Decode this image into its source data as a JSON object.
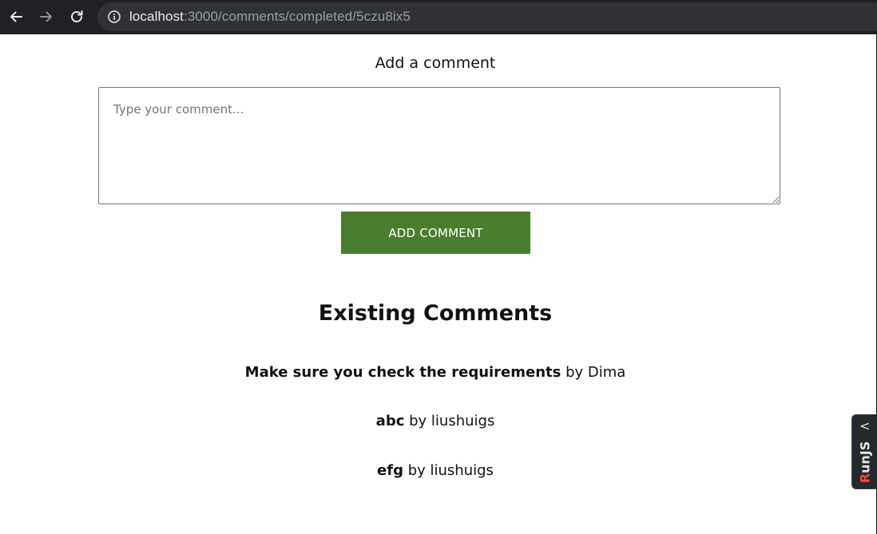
{
  "browser": {
    "url_host": "localhost",
    "url_path": ":3000/comments/completed/5czu8ix5"
  },
  "form": {
    "heading": "Add a comment",
    "placeholder": "Type your comment...",
    "value": "",
    "button_label": "ADD COMMENT",
    "button_color": "#4a7c2e"
  },
  "existing": {
    "heading": "Existing Comments",
    "comments": [
      {
        "text": "Make sure you check the requirements",
        "by": "by Dima"
      },
      {
        "text": "abc",
        "by": "by liushuigs"
      },
      {
        "text": "efg",
        "by": "by liushuigs"
      }
    ]
  },
  "runjs": {
    "label_first": "R",
    "label_rest": "unJS",
    "chevron": "<"
  }
}
